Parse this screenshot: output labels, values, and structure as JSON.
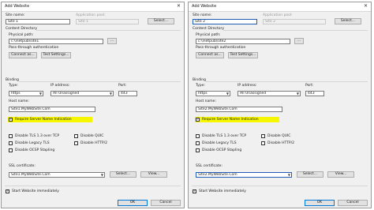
{
  "dialogs": [
    {
      "title": "Add Website",
      "close_glyph": "✕",
      "site_name_label": "Site name:",
      "site_name": "Site 1",
      "app_pool_label": "Application pool:",
      "app_pool": "Site 1",
      "select_label": "Select...",
      "content_directory_label": "Content Directory",
      "physical_path_label": "Physical path:",
      "physical_path": "c:\\inetpub\\site1",
      "browse_label": "...",
      "pass_through_label": "Pass-through authentication",
      "connect_as_label": "Connect as...",
      "test_settings_label": "Test Settings...",
      "binding_label": "Binding",
      "type_label": "Type:",
      "type_value": "https",
      "ip_label": "IP address:",
      "ip_value": "All Unassigned",
      "port_label": "Port:",
      "port_value": "443",
      "host_label": "Host name:",
      "host_value": "Site1.MyWebSite.Com",
      "sni_label": "Require Server Name Indication",
      "sni_checked": true,
      "disable_tls_label": "Disable TLS 1.3 over TCP",
      "disable_quic_label": "Disable QUIC",
      "disable_legacy_label": "Disable Legacy TLS",
      "disable_http2_label": "Disable HTTP/2",
      "disable_ocsp_label": "Disable OCSP Stapling",
      "ssl_label": "SSL certificate:",
      "ssl_value": "Site1.MyWebSite.Com",
      "view_label": "View...",
      "start_label": "Start Website immediately",
      "start_checked": true,
      "ok_label": "OK",
      "cancel_label": "Cancel"
    },
    {
      "title": "Add Website",
      "close_glyph": "✕",
      "site_name_label": "Site name:",
      "site_name": "Site 2",
      "app_pool_label": "Application pool:",
      "app_pool": "Site 2",
      "select_label": "Select...",
      "content_directory_label": "Content Directory",
      "physical_path_label": "Physical path:",
      "physical_path": "c:\\inetpub\\site2",
      "browse_label": "...",
      "pass_through_label": "Pass-through authentication",
      "connect_as_label": "Connect as...",
      "test_settings_label": "Test Settings...",
      "binding_label": "Binding",
      "type_label": "Type:",
      "type_value": "https",
      "ip_label": "IP address:",
      "ip_value": "All Unassigned",
      "port_label": "Port:",
      "port_value": "443",
      "host_label": "Host name:",
      "host_value": "Site2.MyWebSite.Com",
      "sni_label": "Require Server Name Indication",
      "sni_checked": true,
      "disable_tls_label": "Disable TLS 1.3 over TCP",
      "disable_quic_label": "Disable QUIC",
      "disable_legacy_label": "Disable Legacy TLS",
      "disable_http2_label": "Disable HTTP/2",
      "disable_ocsp_label": "Disable OCSP Stapling",
      "ssl_label": "SSL certificate:",
      "ssl_value": "Site2.MyWebSite.Com",
      "view_label": "View...",
      "start_label": "Start Website immediately",
      "start_checked": true,
      "ok_label": "OK",
      "cancel_label": "Cancel"
    }
  ]
}
